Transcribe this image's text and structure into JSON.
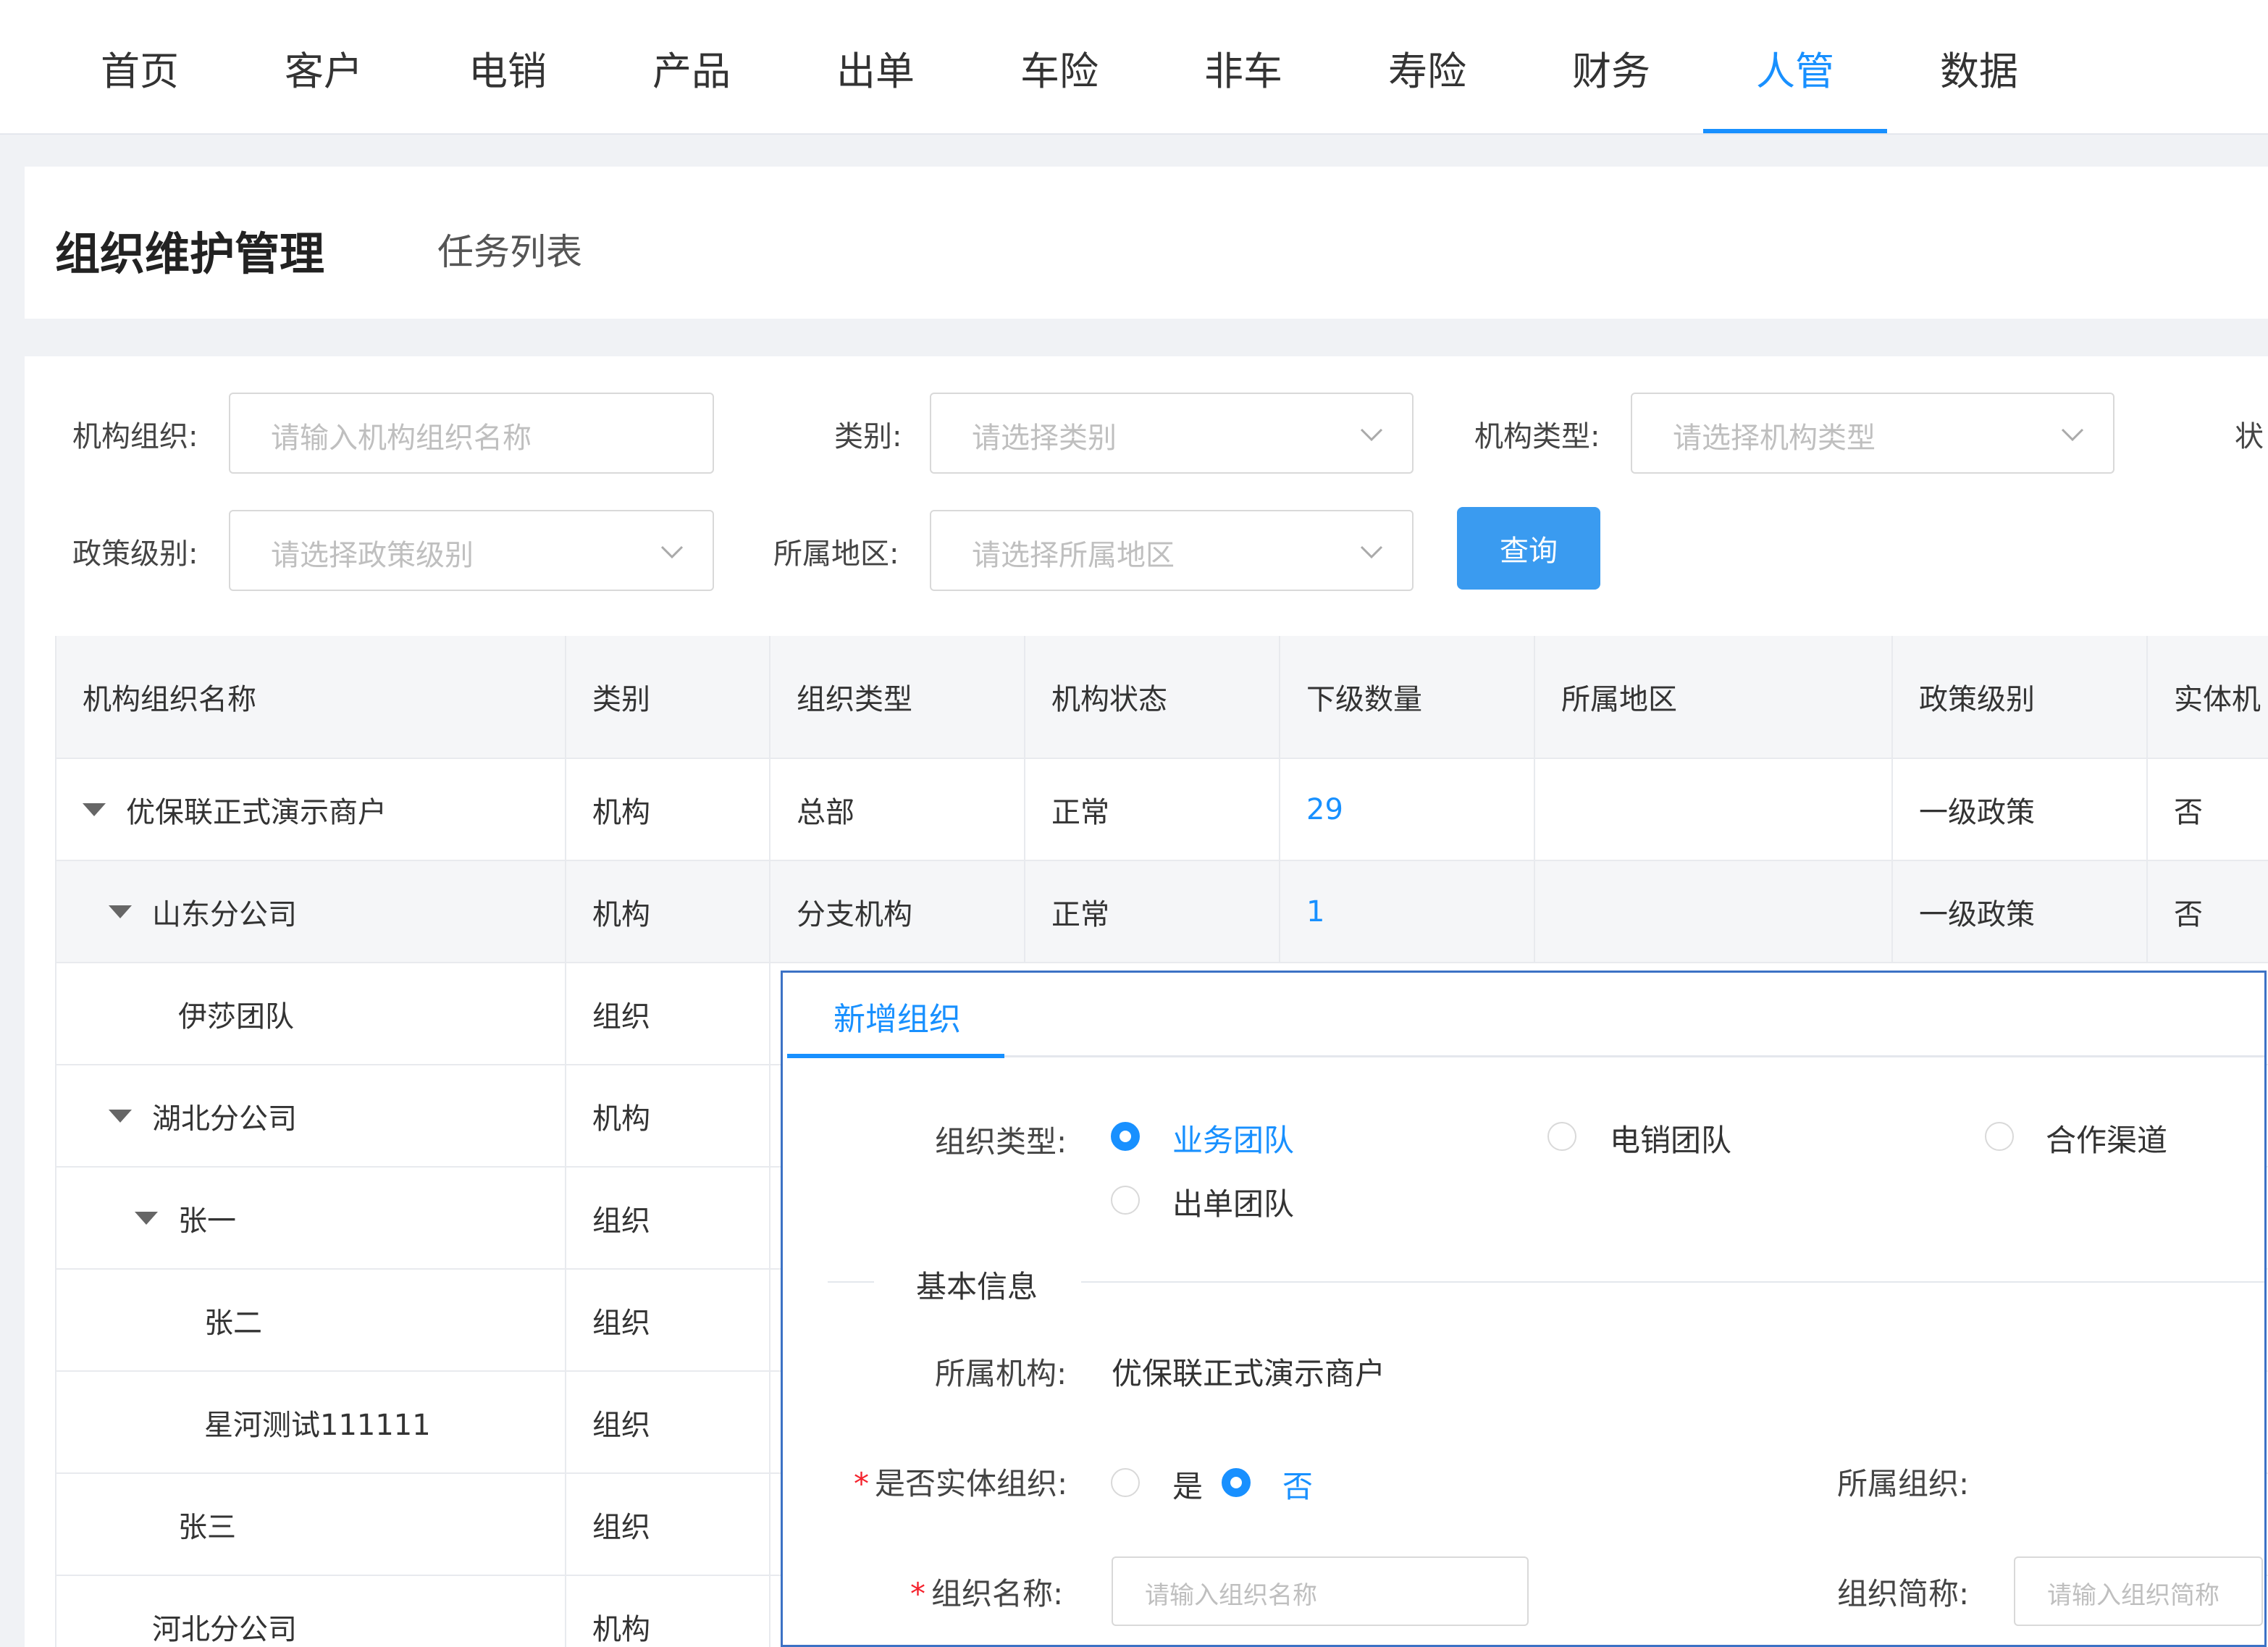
{
  "nav": {
    "items": [
      "首页",
      "客户",
      "电销",
      "产品",
      "出单",
      "车险",
      "非车",
      "寿险",
      "财务",
      "人管",
      "数据"
    ],
    "active_index": 9
  },
  "page": {
    "title": "组织维护管理",
    "subtitle": "任务列表"
  },
  "filters": {
    "org_label": "机构组织:",
    "org_placeholder": "请输入机构组织名称",
    "category_label": "类别:",
    "category_placeholder": "请选择类别",
    "org_type_label": "机构类型:",
    "org_type_placeholder": "请选择机构类型",
    "status_label_partial": "状",
    "policy_label": "政策级别:",
    "policy_placeholder": "请选择政策级别",
    "region_label": "所属地区:",
    "region_placeholder": "请选择所属地区",
    "query_button": "查询"
  },
  "table": {
    "headers": [
      "机构组织名称",
      "类别",
      "组织类型",
      "机构状态",
      "下级数量",
      "所属地区",
      "政策级别",
      "实体机"
    ],
    "rows": [
      {
        "name": "优保联正式演示商户",
        "category": "机构",
        "type": "总部",
        "status": "正常",
        "count": "29",
        "region": "",
        "policy": "一级政策",
        "entity": "否"
      },
      {
        "name": "山东分公司",
        "category": "机构",
        "type": "分支机构",
        "status": "正常",
        "count": "1",
        "region": "",
        "policy": "一级政策",
        "entity": "否"
      },
      {
        "name": "伊莎团队",
        "category": "组织"
      },
      {
        "name": "湖北分公司",
        "category": "机构"
      },
      {
        "name": "张一",
        "category": "组织"
      },
      {
        "name": "张二",
        "category": "组织"
      },
      {
        "name": "星河测试111111",
        "category": "组织"
      },
      {
        "name": "张三",
        "category": "组织"
      },
      {
        "name": "河北分公司",
        "category": "机构"
      }
    ]
  },
  "dialog": {
    "tab": "新增组织",
    "org_type_label": "组织类型:",
    "org_type_options": [
      "业务团队",
      "电销团队",
      "合作渠道",
      "出单团队"
    ],
    "org_type_selected": 0,
    "section_basic": "基本信息",
    "parent_org_label": "所属机构:",
    "parent_org_value": "优保联正式演示商户",
    "is_entity_label": "是否实体组织:",
    "is_entity_options": [
      "是",
      "否"
    ],
    "is_entity_selected": 1,
    "belong_org_label": "所属组织:",
    "org_name_label": "组织名称:",
    "org_name_placeholder": "请输入组织名称",
    "org_short_label": "组织简称:",
    "org_short_placeholder": "请输入组织简称",
    "required_mark": "*"
  },
  "colors": {
    "accent": "#1890ff",
    "query_button": "#3a9bf0",
    "dialog_border": "#3c72c5"
  }
}
